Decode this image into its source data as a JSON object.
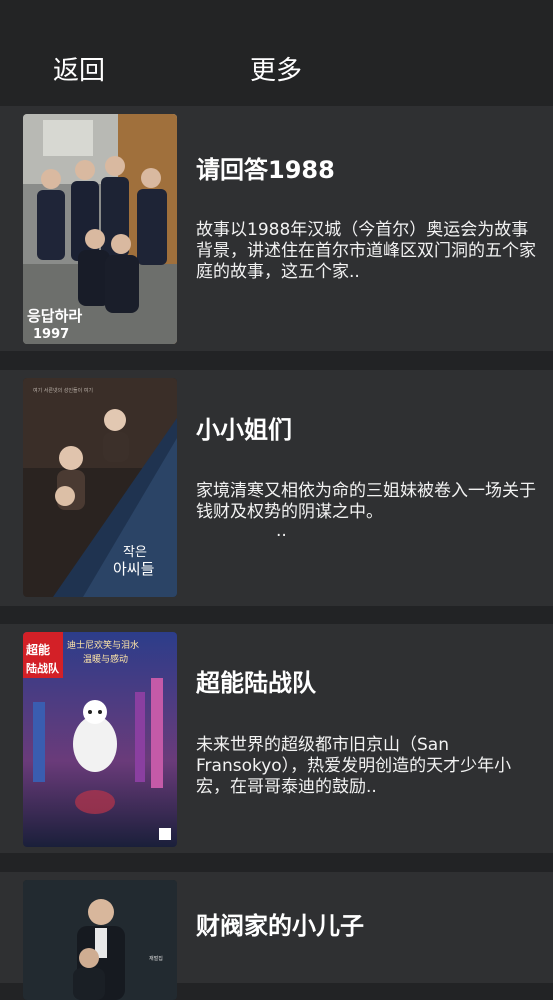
{
  "header": {
    "back_label": "返回",
    "more_label": "更多"
  },
  "items": [
    {
      "title": "请回答1988",
      "description": "故事以1988年汉城（今首尔）奥运会为故事背景，讲述住在首尔市道峰区双门洞的五个家庭的故事，这五个家..",
      "poster_text": "응답하라 1997"
    },
    {
      "title": "小小姐们",
      "description": "家境清寒又相依为命的三姐妹被卷入一场关于钱财及权势的阴谋之中。",
      "extra": "..",
      "poster_text": "작은 아씨들"
    },
    {
      "title": "超能陆战队",
      "description": "未来世界的超级都市旧京山（San Fransokyo），热爱发明创造的天才少年小宏，在哥哥泰迪的鼓励..",
      "poster_text": "超能陆战队",
      "poster_tagline": "迪士尼欢笑与泪水 温暖与感动"
    },
    {
      "title": "财阀家的小儿子",
      "description": "",
      "poster_text": ""
    }
  ],
  "colors": {
    "header_bg": "#232425",
    "card_bg": "#2f3032",
    "divider": "#222325",
    "text": "#ffffff"
  }
}
